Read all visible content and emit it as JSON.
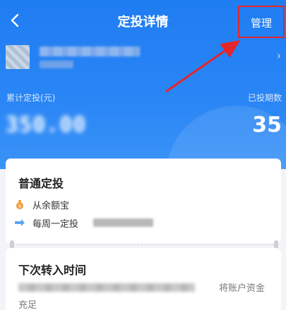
{
  "colors": {
    "header_bg": "#1f7df2",
    "highlight_box": "#e5252a",
    "arrow": "#e5252a"
  },
  "nav": {
    "title": "定投详情",
    "back_icon": "chevron-left-icon",
    "manage_label": "管理"
  },
  "fund": {
    "chevron_icon": "chevron-right-icon"
  },
  "summary": {
    "cumulative_label": "累计定投(元)",
    "cumulative_value": "350.00",
    "periods_label": "已投期数",
    "periods_value": "35"
  },
  "plan": {
    "title": "普通定投",
    "source_icon": "money-bag-icon",
    "source_label": "从余额宝",
    "schedule_icon": "arrow-right-icon",
    "schedule_label": "每周一定投"
  },
  "next": {
    "title": "下次转入时间",
    "note_tail": "将账户资金",
    "note_line2": "充足"
  }
}
